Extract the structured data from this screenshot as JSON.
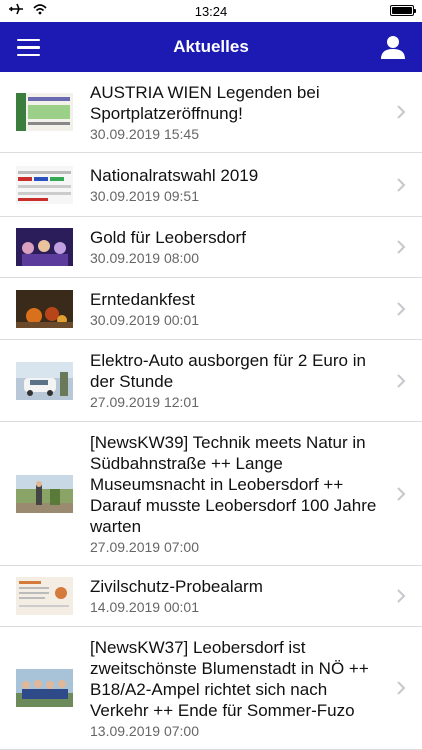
{
  "status": {
    "time": "13:24"
  },
  "nav": {
    "title": "Aktuelles",
    "menu_icon": "hamburger-menu-icon",
    "profile_icon": "user-profile-icon"
  },
  "colors": {
    "nav_bar": "#1d1ab3",
    "separator": "#dcdce0",
    "date_text": "#666666",
    "chevron": "#c7c7cc"
  },
  "news": [
    {
      "title": "AUSTRIA WIEN Legenden bei Sportplatzeröffnung!",
      "date": "30.09.2019 15:45"
    },
    {
      "title": "Nationalratswahl 2019",
      "date": "30.09.2019 09:51"
    },
    {
      "title": "Gold für Leobersdorf",
      "date": "30.09.2019 08:00"
    },
    {
      "title": "Erntedankfest",
      "date": "30.09.2019 00:01"
    },
    {
      "title": "Elektro-Auto ausborgen für 2 Euro in der Stunde",
      "date": "27.09.2019 12:01"
    },
    {
      "title": "[NewsKW39] Technik meets Natur in Südbahnstraße ++ Lange Museumsnacht in Leobersdorf ++ Darauf musste Leobersdorf 100 Jahre warten",
      "date": "27.09.2019 07:00"
    },
    {
      "title": "Zivilschutz-Probealarm",
      "date": "14.09.2019 00:01"
    },
    {
      "title": "[NewsKW37] Leobersdorf ist zweitschönste Blumenstadt in NÖ ++ B18/A2-Ampel richtet sich nach Verkehr ++ Ende für Sommer-Fuzo",
      "date": "13.09.2019 07:00"
    }
  ]
}
